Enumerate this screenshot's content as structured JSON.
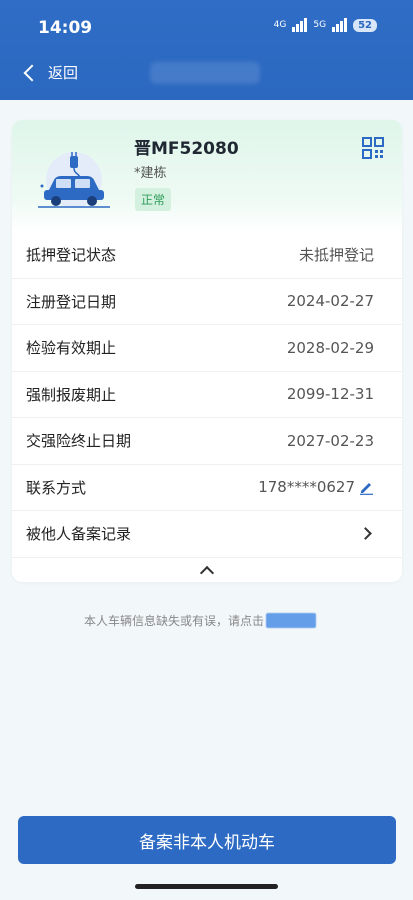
{
  "status_bar": {
    "time": "14:09",
    "network_1": "4G",
    "network_2": "5G",
    "battery": "52"
  },
  "header": {
    "back_label": "返回"
  },
  "vehicle": {
    "plate": "晋MF52080",
    "owner": "*建栋",
    "status": "正常",
    "accent_color": "#2d6ac4",
    "icon": "car-icon"
  },
  "details": [
    {
      "label": "抵押登记状态",
      "value": "未抵押登记"
    },
    {
      "label": "注册登记日期",
      "value": "2024-02-27"
    },
    {
      "label": "检验有效期止",
      "value": "2028-02-29"
    },
    {
      "label": "强制报废期止",
      "value": "2099-12-31"
    },
    {
      "label": "交强险终止日期",
      "value": "2027-02-23"
    },
    {
      "label": "联系方式",
      "value": "178****0627",
      "icon": "edit-icon"
    },
    {
      "label": "被他人备案记录",
      "value": "",
      "icon": "chevron-right-icon"
    }
  ],
  "notice": {
    "text": "本人车辆信息缺失或有误，请点击"
  },
  "footer": {
    "button_label": "备案非本人机动车"
  }
}
